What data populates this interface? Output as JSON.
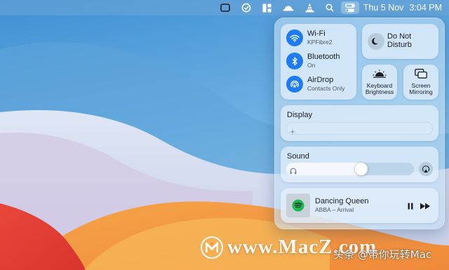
{
  "menubar": {
    "icons": [
      "screen-icon",
      "checkmark-circle-icon",
      "layout-grid-icon",
      "hat-icon",
      "vlc-cone-icon",
      "search-icon",
      "control-center-icon"
    ],
    "date": "Thu 5 Nov",
    "time": "3:04 PM"
  },
  "control_center": {
    "wifi": {
      "title": "Wi-Fi",
      "subtitle": "KPFibre2",
      "icon": "wifi-icon"
    },
    "bluetooth": {
      "title": "Bluetooth",
      "subtitle": "On",
      "icon": "bluetooth-icon"
    },
    "airdrop": {
      "title": "AirDrop",
      "subtitle": "Contacts Only",
      "icon": "airdrop-icon"
    },
    "dnd": {
      "line1": "Do Not",
      "line2": "Disturb",
      "icon": "moon-icon"
    },
    "keyboard_brightness": {
      "line1": "Keyboard",
      "line2": "Brightness",
      "icon": "keyboard-brightness-icon"
    },
    "screen_mirroring": {
      "line1": "Screen",
      "line2": "Mirroring",
      "icon": "screen-mirroring-icon"
    },
    "display": {
      "title": "Display",
      "level": 0.02
    },
    "sound": {
      "title": "Sound",
      "level": 0.6,
      "icon": "headphones-icon",
      "output_icon": "airplay-icon"
    },
    "now_playing": {
      "title": "Dancing Queen",
      "artist": "ABBA – Arrival",
      "app_icon": "spotify-icon"
    }
  },
  "colors": {
    "accent": "#1e7bf2",
    "spotify": "#1db954"
  },
  "watermark": {
    "text": "www.MacZ.com",
    "caption": "头条 @带你玩转Mac"
  }
}
